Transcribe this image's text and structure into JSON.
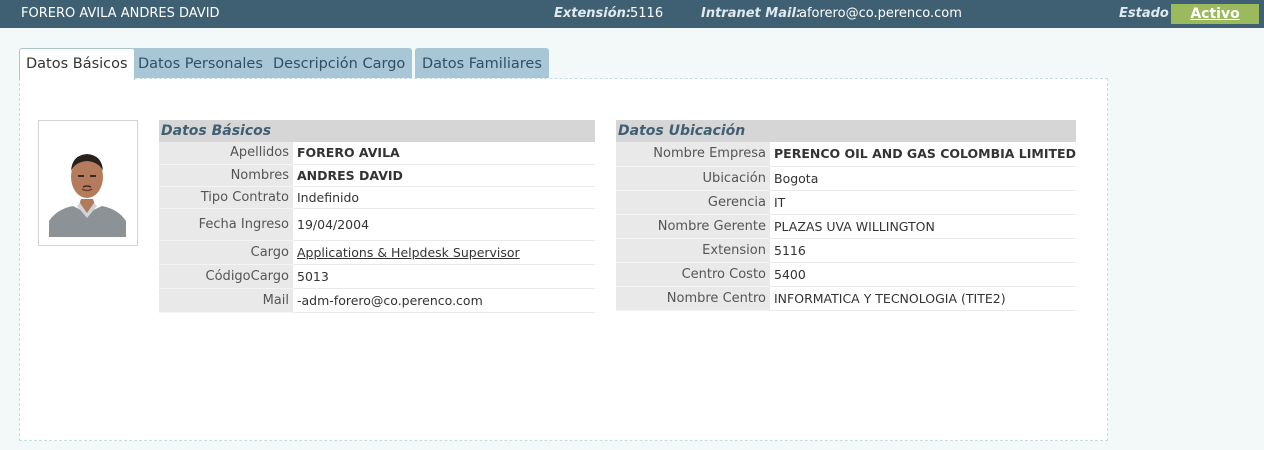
{
  "header": {
    "name": "FORERO AVILA ANDRES DAVID",
    "ext_label": "Extensión:",
    "ext_value": "5116",
    "mail_label": "Intranet Mail:",
    "mail_value": "aforero@co.perenco.com",
    "estado_label": "Estado",
    "estado_value": "Activo"
  },
  "tabs": [
    "Datos Básicos",
    "Datos Personales",
    "Descripción Cargo",
    "Datos Familiares"
  ],
  "basicos": {
    "title": "Datos Básicos",
    "rows": [
      {
        "label": "Apellidos",
        "value": "FORERO AVILA"
      },
      {
        "label": "Nombres",
        "value": "ANDRES DAVID"
      },
      {
        "label": "Tipo Contrato",
        "value": "Indefinido"
      },
      {
        "label": "Fecha Ingreso",
        "value": "19/04/2004"
      },
      {
        "label": "Cargo",
        "value": "Applications & Helpdesk Supervisor"
      },
      {
        "label": "CódigoCargo",
        "value": "5013"
      },
      {
        "label": "Mail",
        "value": "-adm-forero@co.perenco.com"
      }
    ]
  },
  "ubicacion": {
    "title": "Datos Ubicación",
    "rows": [
      {
        "label": "Nombre Empresa",
        "value": "PERENCO OIL AND GAS COLOMBIA LIMITED"
      },
      {
        "label": "Ubicación",
        "value": "Bogota"
      },
      {
        "label": "Gerencia",
        "value": "IT"
      },
      {
        "label": "Nombre Gerente",
        "value": "PLAZAS UVA WILLINGTON"
      },
      {
        "label": "Extension",
        "value": "5116"
      },
      {
        "label": "Centro Costo",
        "value": "5400"
      },
      {
        "label": "Nombre Centro",
        "value": "INFORMATICA Y TECNOLOGIA (TITE2)"
      }
    ]
  }
}
